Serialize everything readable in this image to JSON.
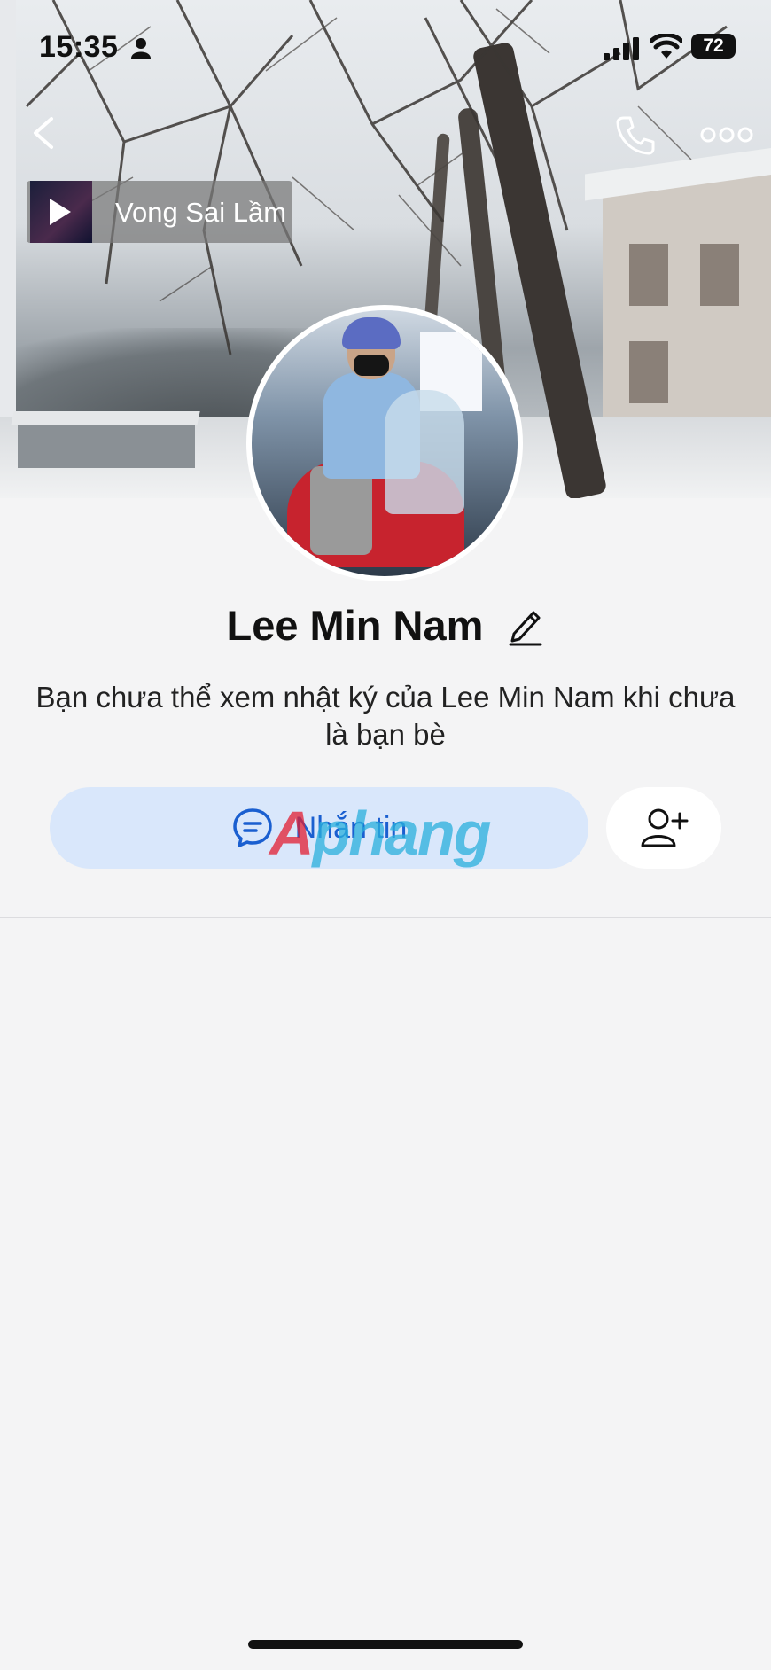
{
  "status_bar": {
    "time": "15:35",
    "battery": "72"
  },
  "music": {
    "title": "Vong Sai Lầm"
  },
  "profile": {
    "name": "Lee Min Nam",
    "notice": "Bạn chưa thể xem nhật ký của Lee Min Nam khi chưa là bạn bè"
  },
  "actions": {
    "message_label": "Nhắn tin"
  },
  "watermark": {
    "part1": "A",
    "part2": "phang"
  },
  "colors": {
    "accent": "#1a5fd0",
    "message_bg": "#d9e7fb",
    "page_bg": "#f4f4f5"
  }
}
